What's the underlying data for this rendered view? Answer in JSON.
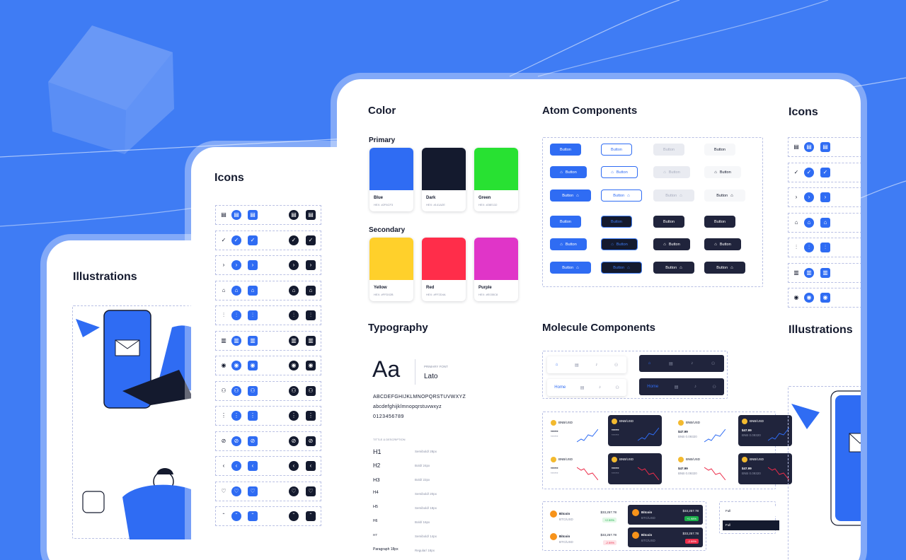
{
  "colors": {
    "background": "#3f7cf4",
    "accent": "#2f6cf3",
    "dark": "#141a2e"
  },
  "illustrations_card": {
    "title": "Illustrations"
  },
  "icons_card": {
    "title": "Icons",
    "rows": [
      {
        "icon": "calendar-icon",
        "glyph": "▤"
      },
      {
        "icon": "check-icon",
        "glyph": "✓"
      },
      {
        "icon": "chevron-right-icon",
        "glyph": "›"
      },
      {
        "icon": "home-icon",
        "glyph": "⌂"
      },
      {
        "icon": "sliders-icon",
        "glyph": "⫶"
      },
      {
        "icon": "trash-icon",
        "glyph": "▥"
      },
      {
        "icon": "eye-icon",
        "glyph": "◉"
      },
      {
        "icon": "user-icon",
        "glyph": "⚇"
      },
      {
        "icon": "more-vertical-icon",
        "glyph": "⋮"
      },
      {
        "icon": "eye-off-icon",
        "glyph": "⊘"
      },
      {
        "icon": "chevron-left-icon",
        "glyph": "‹"
      },
      {
        "icon": "heart-icon",
        "glyph": "♡"
      },
      {
        "icon": "chevron-up-icon",
        "glyph": "ˆ"
      }
    ]
  },
  "color_section": {
    "title": "Color",
    "primary_label": "Primary",
    "secondary_label": "Secondary",
    "primary": [
      {
        "name": "Blue",
        "hex_text": "HEX: #2F6CF3",
        "color": "#2f6cf3"
      },
      {
        "name": "Dark",
        "hex_text": "HEX: #141A2E",
        "color": "#141a2e"
      },
      {
        "name": "Green",
        "hex_text": "HEX: #28E132",
        "color": "#28e132"
      }
    ],
    "secondary": [
      {
        "name": "Yellow",
        "hex_text": "HEX: #FFD02B",
        "color": "#ffd02b"
      },
      {
        "name": "Red",
        "hex_text": "HEX: #FF2D4A",
        "color": "#ff2d4a"
      },
      {
        "name": "Purple",
        "hex_text": "HEX: #E035C8",
        "color": "#e035c8"
      }
    ]
  },
  "atom_section": {
    "title": "Atom Components",
    "button_label": "Button"
  },
  "typography": {
    "title": "Typography",
    "sample": "Aa",
    "font_caption": "PRIMARY FONT",
    "font_name": "Lato",
    "uppercase": "ABCDEFGHIJKLMNOPQRSTUVWXYZ",
    "lowercase": "abcdefghijklmnopqrstuvwxyz",
    "digits": "0123456789",
    "section_caption": "TITTLE & DESCRIPTION",
    "scale": [
      {
        "label": "H1",
        "value": "Semibold/ 28px"
      },
      {
        "label": "H2",
        "value": "Bold/ 24px"
      },
      {
        "label": "H3",
        "value": "Bold/ 22px"
      },
      {
        "label": "H4",
        "value": "Semibold/ 20px"
      },
      {
        "label": "H5",
        "value": "Semibold/ 18px"
      },
      {
        "label": "H6",
        "value": "Bold/ 16px"
      },
      {
        "label": "H7",
        "value": "Semibold/ 14px"
      },
      {
        "label": "Paragraph 18px",
        "value": "Regular/ 18px"
      }
    ]
  },
  "molecule_section": {
    "title": "Molecule Components",
    "nav_home": "Home",
    "pair": "BNB/USD",
    "price": "$47.99",
    "price_sub": "BNB 0.09320",
    "masked": "******",
    "coin_name": "Bitcoin",
    "coin_sym": "BTC/USD",
    "coin_price": "$33,257.78",
    "change_up": "+2.59%",
    "change_down": "-2.59%",
    "change_up_dark": "+1.98%",
    "fill_label": "Full"
  },
  "right_column": {
    "icons_title": "Icons",
    "illustrations_title": "Illustrations"
  }
}
